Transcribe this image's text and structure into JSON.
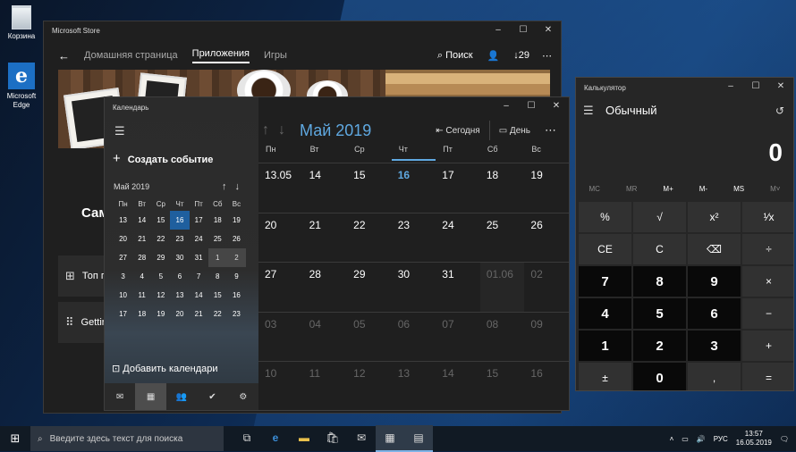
{
  "desktop": {
    "icons": [
      {
        "label": "Корзина",
        "icon": "recycle-bin-icon"
      },
      {
        "label": "Microsoft Edge",
        "icon": "edge-icon"
      }
    ]
  },
  "store": {
    "title": "Microsoft Store",
    "nav": {
      "home": "Домашняя страница",
      "apps": "Приложения",
      "games": "Игры",
      "search": "Поиск",
      "downloads": "29"
    },
    "hero_text": "Сам",
    "cards": [
      {
        "label": "Топ п"
      },
      {
        "label": "Gettin"
      }
    ]
  },
  "calendar": {
    "title": "Календарь",
    "new_event": "Создать событие",
    "mini_month": "Май 2019",
    "weekdays": [
      "Пн",
      "Вт",
      "Ср",
      "Чт",
      "Пт",
      "Сб",
      "Вс"
    ],
    "mini_days": [
      [
        "13",
        "14",
        "15",
        "16",
        "17",
        "18",
        "19"
      ],
      [
        "20",
        "21",
        "22",
        "23",
        "24",
        "25",
        "26"
      ],
      [
        "27",
        "28",
        "29",
        "30",
        "31",
        "1",
        "2"
      ],
      [
        "3",
        "4",
        "5",
        "6",
        "7",
        "8",
        "9"
      ],
      [
        "10",
        "11",
        "12",
        "13",
        "14",
        "15",
        "16"
      ],
      [
        "17",
        "18",
        "19",
        "20",
        "21",
        "22",
        "23"
      ]
    ],
    "add_calendars": "Добавить календари",
    "main_month": "Май 2019",
    "today_btn": "Сегодня",
    "day_btn": "День",
    "grid": [
      [
        "13.05",
        "14",
        "15",
        "16",
        "17",
        "18",
        "19"
      ],
      [
        "20",
        "21",
        "22",
        "23",
        "24",
        "25",
        "26"
      ],
      [
        "27",
        "28",
        "29",
        "30",
        "31",
        "01.06",
        "02"
      ],
      [
        "03",
        "04",
        "05",
        "06",
        "07",
        "08",
        "09"
      ],
      [
        "10",
        "11",
        "12",
        "13",
        "14",
        "15",
        "16"
      ]
    ]
  },
  "calculator": {
    "title": "Калькулятор",
    "mode": "Обычный",
    "display": "0",
    "memory": [
      "MC",
      "MR",
      "M+",
      "M-",
      "MS",
      "M˅"
    ],
    "keys": [
      "%",
      "√",
      "x²",
      "¹⁄x",
      "CE",
      "C",
      "⌫",
      "÷",
      "7",
      "8",
      "9",
      "×",
      "4",
      "5",
      "6",
      "−",
      "1",
      "2",
      "3",
      "+",
      "±",
      "0",
      ",",
      "="
    ]
  },
  "taskbar": {
    "search_placeholder": "Введите здесь текст для поиска",
    "lang": "РУС",
    "time": "13:57",
    "date": "16.05.2019"
  }
}
